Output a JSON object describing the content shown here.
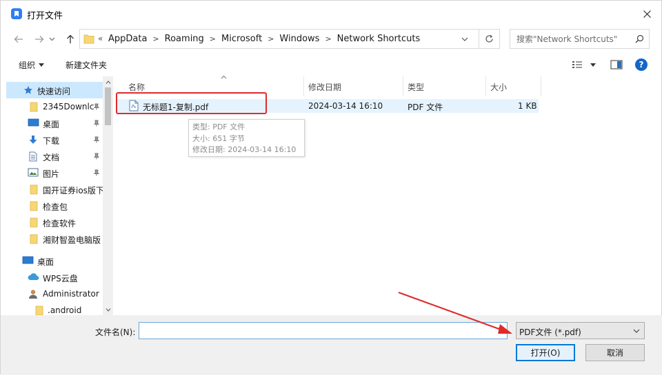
{
  "window": {
    "title": "打开文件",
    "close_glyph": "✕"
  },
  "nav": {
    "back_icon": "arrow-left-icon",
    "forward_icon": "arrow-right-icon",
    "recent_icon": "chevron-down-icon",
    "up_icon": "arrow-up-icon",
    "overflow": "«",
    "breadcrumbs": [
      "AppData",
      "Roaming",
      "Microsoft",
      "Windows",
      "Network Shortcuts"
    ],
    "search_placeholder": "搜索\"Network Shortcuts\""
  },
  "toolbar": {
    "organize": "组织",
    "new_folder": "新建文件夹",
    "help": "?"
  },
  "sidebar": {
    "items": [
      {
        "label": "快速访问",
        "icon": "star-icon",
        "pinned": false
      },
      {
        "label": "2345Downlc",
        "icon": "folder-icon",
        "pinned": true
      },
      {
        "label": "桌面",
        "icon": "desktop-icon",
        "pinned": true
      },
      {
        "label": "下载",
        "icon": "download-icon",
        "pinned": true
      },
      {
        "label": "文档",
        "icon": "document-icon",
        "pinned": true
      },
      {
        "label": "图片",
        "icon": "picture-icon",
        "pinned": true
      },
      {
        "label": "国开证券ios版下",
        "icon": "folder-icon",
        "pinned": false
      },
      {
        "label": "检查包",
        "icon": "folder-icon",
        "pinned": false
      },
      {
        "label": "检查软件",
        "icon": "folder-icon",
        "pinned": false
      },
      {
        "label": "湘财智盈电脑版",
        "icon": "folder-icon",
        "pinned": false
      },
      {
        "label": "桌面",
        "icon": "desktop-icon",
        "pinned": false
      },
      {
        "label": "WPS云盘",
        "icon": "cloud-icon",
        "pinned": false
      },
      {
        "label": "Administrator",
        "icon": "user-icon",
        "pinned": false
      },
      {
        "label": ".android",
        "icon": "folder-icon",
        "pinned": false
      }
    ]
  },
  "columns": [
    "名称",
    "修改日期",
    "类型",
    "大小"
  ],
  "files": [
    {
      "name": "无标题1-复制.pdf",
      "modified": "2024-03-14 16:10",
      "type": "PDF 文件",
      "size": "1 KB"
    }
  ],
  "tooltip": {
    "type_line": "类型: PDF 文件",
    "size_line": "大小: 651 字节",
    "date_line": "修改日期: 2024-03-14 16:10"
  },
  "bottom": {
    "filename_label": "文件名(N):",
    "filename_value": "",
    "filter": "PDF文件 (*.pdf)",
    "open_label": "打开(O)",
    "cancel_label": "取消"
  },
  "colors": {
    "accent": "#0078d7",
    "selection": "#cce8ff",
    "row_hover": "#e5f3ff",
    "annotation_red": "#e02a2a"
  }
}
